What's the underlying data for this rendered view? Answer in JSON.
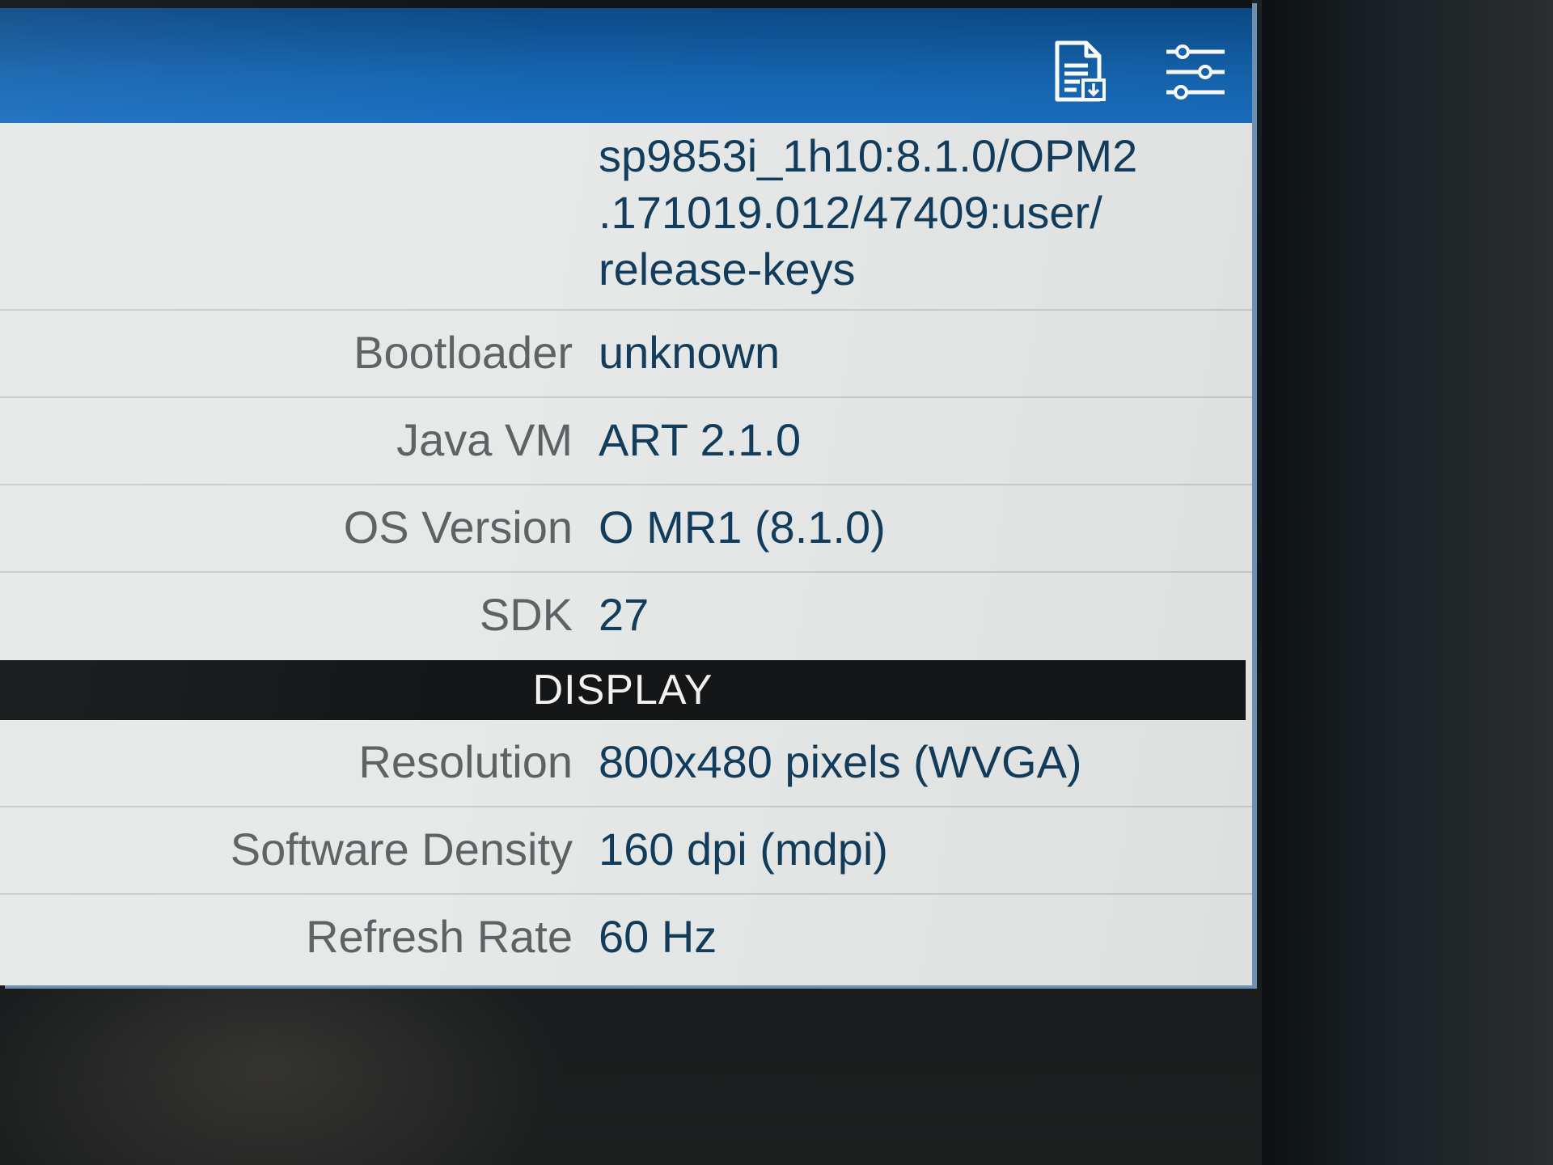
{
  "toolbar": {
    "icons": [
      "report-icon",
      "sliders-icon"
    ]
  },
  "system": {
    "fingerprint_value": "sp9853i_1h10:8.1.0/OPM2 .171019.012/47409:user/ release-keys",
    "rows": [
      {
        "label": "Bootloader",
        "value": "unknown"
      },
      {
        "label": "Java VM",
        "value": "ART 2.1.0"
      },
      {
        "label": "OS Version",
        "value": "O MR1 (8.1.0)"
      },
      {
        "label": "SDK",
        "value": "27"
      }
    ]
  },
  "display": {
    "header": "DISPLAY",
    "rows": [
      {
        "label": "Resolution",
        "value": "800x480 pixels (WVGA)"
      },
      {
        "label": "Software Density",
        "value": "160 dpi (mdpi)"
      },
      {
        "label": "Refresh Rate",
        "value": "60 Hz"
      }
    ]
  },
  "colors": {
    "app_bar": "#1565b0",
    "section_header": "#141618",
    "label_text": "#5e6264",
    "value_text": "#123d5c"
  }
}
